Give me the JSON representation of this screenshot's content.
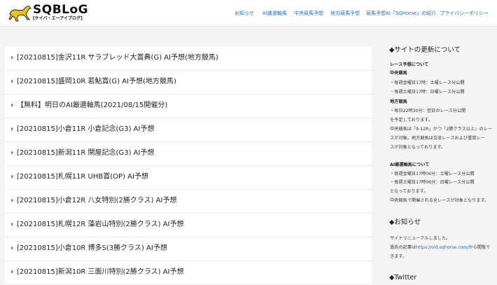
{
  "header": {
    "logo_text": "SQBLoG",
    "logo_sub": "[ケイバ・エーアイブログ]",
    "nav": [
      "お知らせ",
      "AI厳選軸馬",
      "中央競馬予想",
      "地方競馬予想",
      "競馬予想AI「SQHorse」の紹介",
      "プライバシーポリシー"
    ]
  },
  "posts": [
    "[20210815]金沢11R サラブレッド大賞典(G) AI予想(地方競馬)",
    "[20210815]盛岡10R 若鮎賞(G) AI予想(地方競馬)",
    "【無料】明日のAI厳選軸馬(2021/08/15開催分)",
    "[20210815]小倉11R 小倉記念(G3) AI予想",
    "[20210815]新潟11R 関屋記念(G3) AI予想",
    "[20210815]札幌11R UHB賞(OP) AI予想",
    "[20210815]小倉12R 八女特別(2勝クラス) AI予想",
    "[20210815]札幌12R 藻岩山特別(2勝クラス) AI予想",
    "[20210815]小倉10R 博多S(3勝クラス) AI予想",
    "[20210815]新潟10R 三面川特別(2勝クラス) AI予想"
  ],
  "sidebar": {
    "update_title": "◆サイトの更新について",
    "race_heading": "レース予想について",
    "central_heading": "中央競馬",
    "central_1": "・毎週金曜日17時：土曜レース分公開",
    "central_2": "・毎週土曜日17時：日曜レース分公開",
    "local_heading": "地方競馬",
    "local_1": "・毎日22時30分：翌日のレース分公開",
    "plan": "を予定しております。",
    "note_1": "中央競馬は「9-12R」かつ「2勝クラス以上」のレー",
    "note_2": "スが対象。地方競馬は交流レースおよび重賞レー",
    "note_3": "スが対象となっております。",
    "ai_heading": "AI厳選軸馬について",
    "ai_1": "・毎週金曜日17時06分：土曜レース分公開",
    "ai_2": "・毎週土曜日17時06分：日曜レース分公開",
    "ai_3": "となっております。",
    "ai_4": "中央競馬で開催される全レースが対象となります。",
    "news_title": "◆お知らせ",
    "news_1": "サイトリニューアルしました。",
    "news_2_pre": "過去の記事は",
    "news_2_link": "https://old.sqhorse.com/",
    "news_2_post": "から閲覧で",
    "news_3": "きます。",
    "twitter_title": "◆Twitter"
  },
  "colors": {
    "link": "#1d6fb8",
    "chevron": "#1a3a7a",
    "background": "#f4f4f4"
  }
}
